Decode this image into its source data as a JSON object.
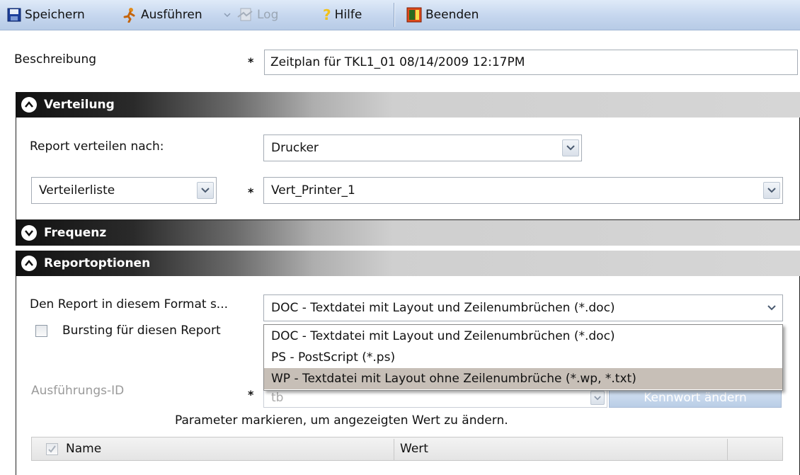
{
  "toolbar": {
    "save": "Speichern",
    "run": "Ausführen",
    "log": "Log",
    "help": "Hilfe",
    "quit": "Beenden"
  },
  "description": {
    "label": "Beschreibung",
    "required": "*",
    "value": "Zeitplan für TKL1_01 08/14/2009 12:17PM"
  },
  "distribution": {
    "title": "Verteilung",
    "distribute_label": "Report verteilen nach:",
    "distribute_value": "Drucker",
    "list_type": "Verteilerliste",
    "required": "*",
    "list_value": "Vert_Printer_1"
  },
  "frequency": {
    "title": "Frequenz"
  },
  "report_options": {
    "title": "Reportoptionen",
    "format_label": "Den Report in diesem Format s...",
    "format_value": "DOC - Textdatei mit Layout und Zeilenumbrüchen (*.doc)",
    "bursting_label": "Bursting für diesen Report",
    "bursting_checked": false,
    "exec_id_label": "Ausführungs-ID",
    "required": "*",
    "exec_id_value": "tb",
    "change_password_button": "Kennwort ändern",
    "param_hint": "Parameter markieren, um angezeigten Wert zu ändern.",
    "table_headers": [
      "Name",
      "Wert"
    ]
  },
  "format_dropdown": {
    "options": [
      "DOC - Textdatei mit Layout und Zeilenumbrüchen (*.doc)",
      "PS - PostScript (*.ps)",
      "WP - Textdatei mit Layout ohne Zeilenumbrüche (*.wp, *.txt)"
    ],
    "highlighted_index": 2
  },
  "colors": {
    "toolbar_bg": "#c5d6ee",
    "section_header_dark": "#111111",
    "highlight": "#c7bfb7"
  }
}
